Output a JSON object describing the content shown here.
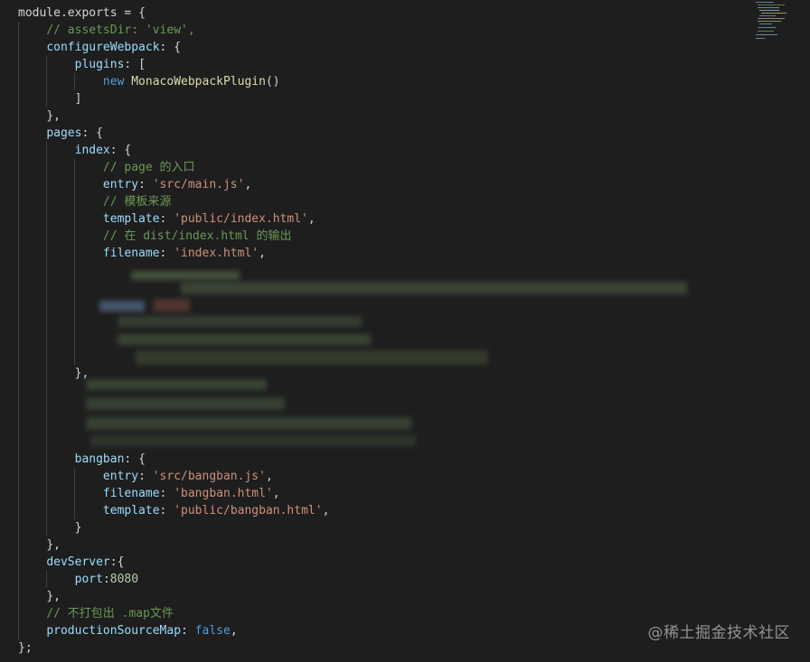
{
  "code": {
    "l1_obj": "module",
    "l1_prop": "exports",
    "l1_rest": " = {",
    "l2_comment": "// assetsDir: 'view',",
    "l3_key": "configureWebpack",
    "l3_rest": ": {",
    "l4_key": "plugins",
    "l4_rest": ": [",
    "l5_kw": "new",
    "l5_class": "MonacoWebpackPlugin",
    "l5_rest": "()",
    "l6": "]",
    "l7": "},",
    "l8_key": "pages",
    "l8_rest": ": {",
    "l9_key": "index",
    "l9_rest": ": {",
    "l10_comment": "// page 的入口",
    "l11_key": "entry",
    "l11_str": "'src/main.js'",
    "l12_comment": "// 模板来源",
    "l13_key": "template",
    "l13_str": "'public/index.html'",
    "l14_comment": "// 在 dist/index.html 的输出",
    "l15_key": "filename",
    "l15_str": "'index.html'",
    "l22": "},",
    "l27_key": "bangban",
    "l27_rest": ": {",
    "l28_key": "entry",
    "l28_str": "'src/bangban.js'",
    "l29_key": "filename",
    "l29_str": "'bangban.html'",
    "l30_key": "template",
    "l30_str": "'public/bangban.html'",
    "l31": "}",
    "l32": "},",
    "l33_key": "devServer",
    "l33_rest": ":{",
    "l34_key": "port",
    "l34_num": "8080",
    "l35": "},",
    "l36_comment": "// 不打包出 .map文件",
    "l37_key": "productionSourceMap",
    "l37_kw": "false",
    "l38": "};"
  },
  "watermark": "@稀土掘金技术社区",
  "colors": {
    "background": "#1e1e1e",
    "keyword": "#569cd6",
    "function": "#dcdcaa",
    "property": "#9cdcfe",
    "string": "#ce9178",
    "number": "#b5cea8",
    "comment": "#6a9955"
  }
}
